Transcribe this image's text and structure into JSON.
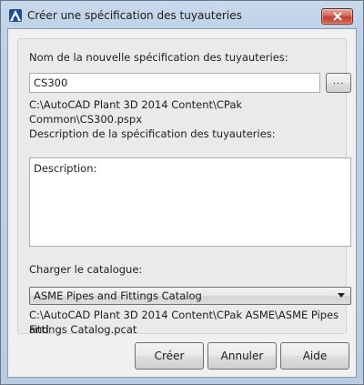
{
  "window": {
    "title": "Créer une spécification des tuyauteries",
    "app_icon": "autocad-logo-icon",
    "close_icon": "close-icon",
    "close_button_color": "#c7432f"
  },
  "form": {
    "name_label": "Nom de la nouvelle spécification des tuyauteries:",
    "name_value": "CS300",
    "browse_label": "...",
    "spec_path": "C:\\AutoCAD Plant 3D 2014 Content\\CPak Common\\CS300.pspx",
    "description_label": "Description de la spécification des tuyauteries:",
    "description_value": "Description:",
    "catalog_label": "Charger le catalogue:",
    "catalog_selected": "ASME Pipes and Fittings Catalog",
    "catalog_path_line1": "C:\\AutoCAD Plant 3D 2014 Content\\CPak ASME\\ASME Pipes and",
    "catalog_path_line2": "Fittings Catalog.pcat"
  },
  "buttons": {
    "create": "Créer",
    "cancel": "Annuler",
    "help": "Aide"
  }
}
